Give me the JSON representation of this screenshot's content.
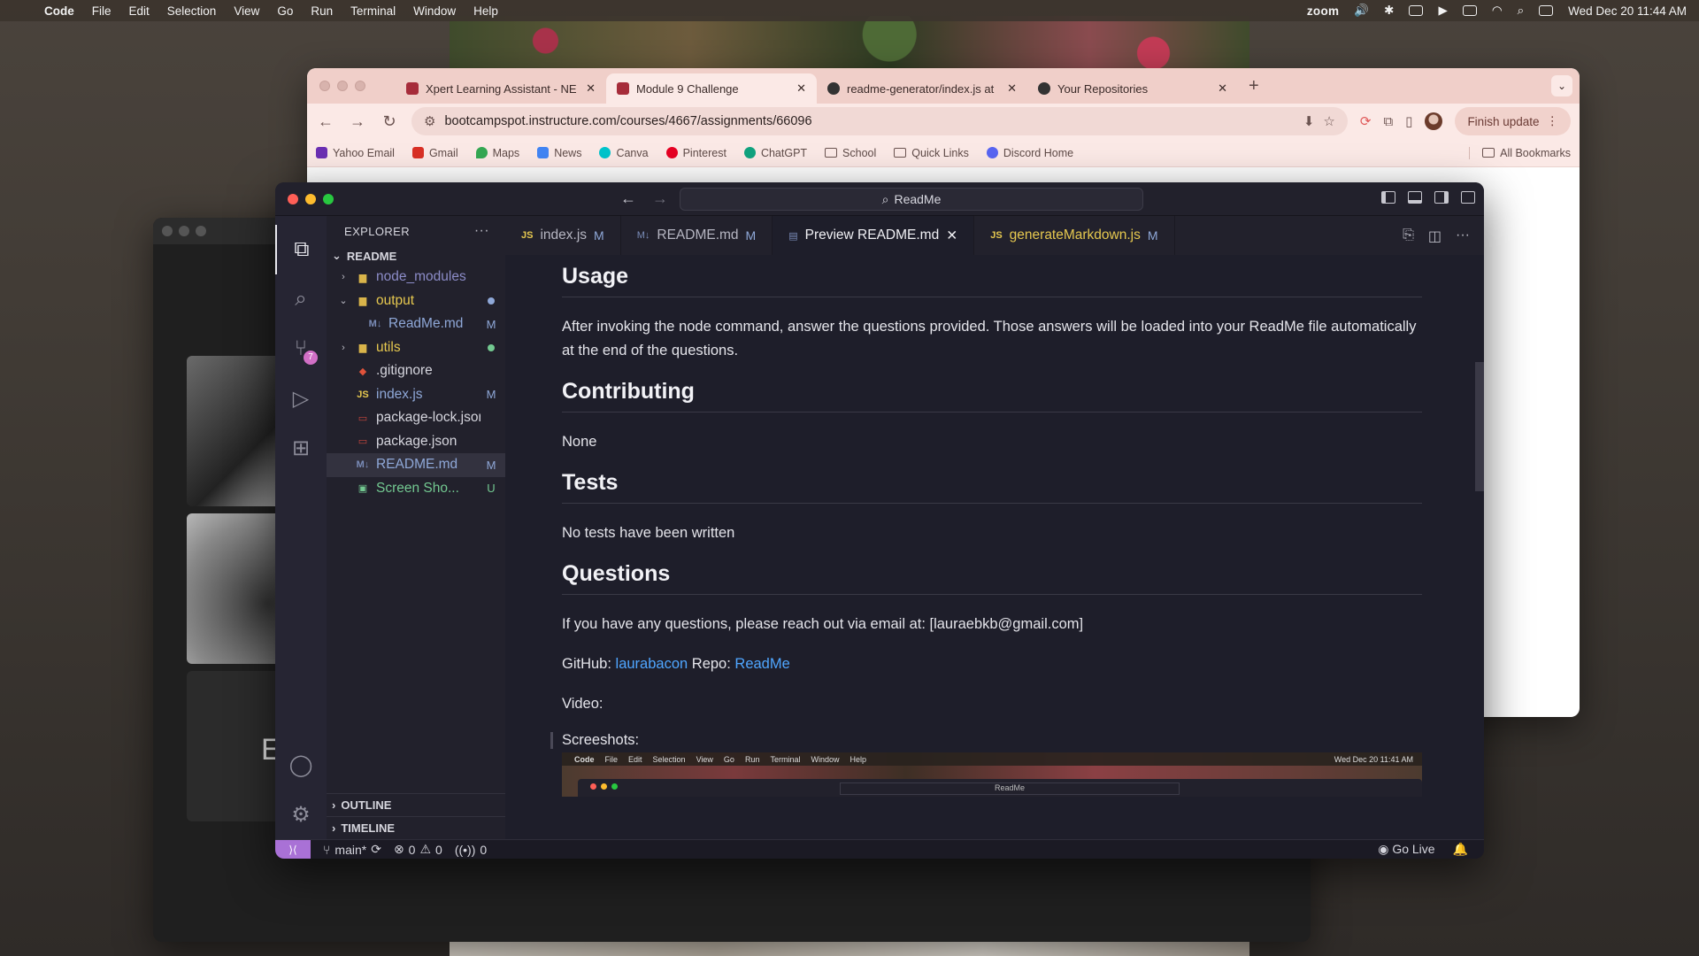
{
  "menubar": {
    "app": "Code",
    "items": [
      "File",
      "Edit",
      "Selection",
      "View",
      "Go",
      "Run",
      "Terminal",
      "Window",
      "Help"
    ],
    "zoom": "zoom",
    "datetime": "Wed Dec 20  11:44 AM"
  },
  "zoom_window": {
    "tile_letter": "E"
  },
  "chrome": {
    "tabs": [
      {
        "title": "Xpert Learning Assistant - NE",
        "active": false
      },
      {
        "title": "Module 9 Challenge",
        "active": true
      },
      {
        "title": "readme-generator/index.js at",
        "active": false
      },
      {
        "title": "Your Repositories",
        "active": false
      }
    ],
    "url": "bootcampspot.instructure.com/courses/4667/assignments/66096",
    "finish_update": "Finish update",
    "bookmarks": [
      {
        "label": "Yahoo Email",
        "color": "#6b2fb3"
      },
      {
        "label": "Gmail",
        "color": "#d93025"
      },
      {
        "label": "Maps",
        "color": "#34a853"
      },
      {
        "label": "News",
        "color": "#4285f4"
      },
      {
        "label": "Canva",
        "color": "#00c4cc"
      },
      {
        "label": "Pinterest",
        "color": "#e60023"
      },
      {
        "label": "ChatGPT",
        "color": "#10a37f"
      },
      {
        "label": "School",
        "folder": true
      },
      {
        "label": "Quick Links",
        "folder": true
      },
      {
        "label": "Discord Home",
        "color": "#5865f2"
      }
    ],
    "all_bookmarks": "All Bookmarks"
  },
  "vscode": {
    "command_center": "ReadMe",
    "activity_badge": "7",
    "explorer": {
      "header": "EXPLORER",
      "section": "README",
      "tree": [
        {
          "name": "node_modules",
          "chev": "›",
          "icon": "folder",
          "status": "",
          "color": "#8c8cc8",
          "indent": 0
        },
        {
          "name": "output",
          "chev": "⌄",
          "icon": "folder",
          "status": "dot",
          "color": "#e6c84f",
          "indent": 0
        },
        {
          "name": "ReadMe.md",
          "chev": "",
          "icon": "md",
          "status": "M",
          "color": "#8fa8d8",
          "indent": 1
        },
        {
          "name": "utils",
          "chev": "›",
          "icon": "folder",
          "status": "dot-green",
          "color": "#e6c84f",
          "indent": 0
        },
        {
          "name": ".gitignore",
          "chev": "",
          "icon": "git",
          "status": "",
          "color": "#d6d6de",
          "indent": 0
        },
        {
          "name": "index.js",
          "chev": "",
          "icon": "JS",
          "status": "M",
          "color": "#8fa8d8",
          "indent": 0
        },
        {
          "name": "package-lock.json",
          "chev": "",
          "icon": "npm",
          "status": "",
          "color": "#d6d6de",
          "indent": 0
        },
        {
          "name": "package.json",
          "chev": "",
          "icon": "npm",
          "status": "",
          "color": "#d6d6de",
          "indent": 0
        },
        {
          "name": "README.md",
          "chev": "",
          "icon": "md",
          "status": "M",
          "color": "#8fa8d8",
          "indent": 0,
          "selected": true
        },
        {
          "name": "Screen Sho...",
          "chev": "",
          "icon": "img",
          "status": "U",
          "color": "#73c991",
          "indent": 0
        }
      ],
      "outline": "OUTLINE",
      "timeline": "TIMELINE"
    },
    "tabs": [
      {
        "label": "index.js",
        "kind": "JS",
        "mod": "M"
      },
      {
        "label": "README.md",
        "kind": "MD",
        "mod": "M"
      },
      {
        "label": "Preview README.md",
        "kind": "PREVIEW",
        "mod": "",
        "active": true
      },
      {
        "label": "generateMarkdown.js",
        "kind": "JS",
        "mod": "M"
      }
    ],
    "preview": {
      "usage_heading": "Usage",
      "usage_text": "After invoking the node command, answer the questions provided. Those answers will be loaded into your ReadMe file automatically at the end of the questions.",
      "contributing_heading": "Contributing",
      "contributing_text": "None",
      "tests_heading": "Tests",
      "tests_text": "No tests have been written",
      "questions_heading": "Questions",
      "questions_text": "If you have any questions, please reach out via email at: [lauraebkb@gmail.com]",
      "github_label": "GitHub:",
      "github_user": "laurabacon",
      "repo_label": "Repo:",
      "repo_link": "ReadMe",
      "video_label": "Video:",
      "screenshots_label": "Screeshots:",
      "mini_cmd": "ReadMe",
      "mini_menu": [
        "Code",
        "File",
        "Edit",
        "Selection",
        "View",
        "Go",
        "Run",
        "Terminal",
        "Window",
        "Help"
      ],
      "mini_datetime": "Wed Dec 20  11:41 AM"
    },
    "status": {
      "branch": "main*",
      "errors": "0",
      "warnings": "0",
      "ports": "0",
      "go_live": "Go Live"
    }
  }
}
